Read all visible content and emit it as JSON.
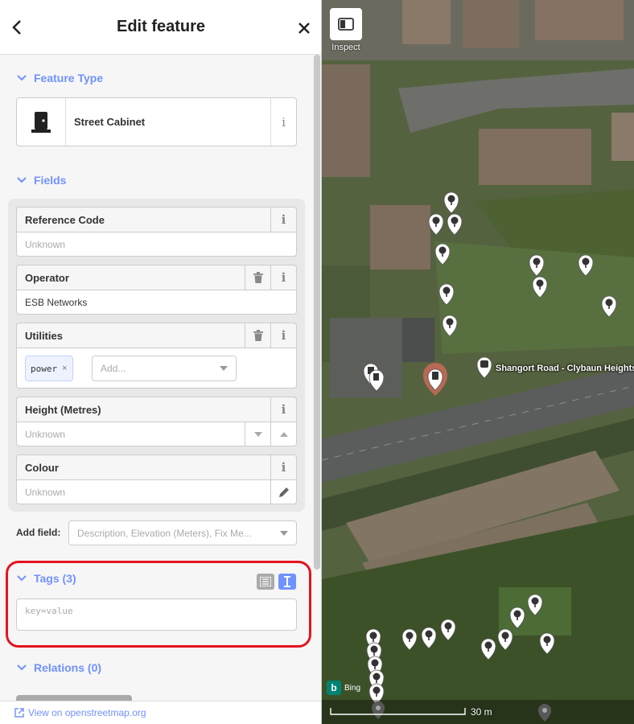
{
  "header": {
    "title": "Edit feature",
    "back_label": "<",
    "close_label": "✕"
  },
  "feature_type": {
    "section_label": "Feature Type",
    "preset_name": "Street Cabinet",
    "preset_icon": "door-icon"
  },
  "fields": {
    "section_label": "Fields",
    "reference_code": {
      "label": "Reference Code",
      "placeholder": "Unknown"
    },
    "operator": {
      "label": "Operator",
      "value": "ESB Networks"
    },
    "utilities": {
      "label": "Utilities",
      "chip": "power",
      "chip_remove": "×",
      "add_placeholder": "Add..."
    },
    "height": {
      "label": "Height (Metres)",
      "placeholder": "Unknown"
    },
    "colour": {
      "label": "Colour",
      "placeholder": "Unknown"
    },
    "info_glyph": "i"
  },
  "add_field": {
    "label": "Add field:",
    "placeholder": "Description, Elevation (Meters), Fix Me..."
  },
  "tags": {
    "section_label": "Tags (3)",
    "placeholder": "key=value",
    "highlight_color": "#e3141f"
  },
  "relations": {
    "section_label": "Relations (0)"
  },
  "footer": {
    "link": "View on openstreetmap.org"
  },
  "map": {
    "inspect_label": "Inspect",
    "road_label": "Shangort Road - Clybaun Heights",
    "imagery": "Bing",
    "scale_label": "30 m",
    "selected_color": "#c96b58"
  },
  "accent_color": "#7092ff"
}
